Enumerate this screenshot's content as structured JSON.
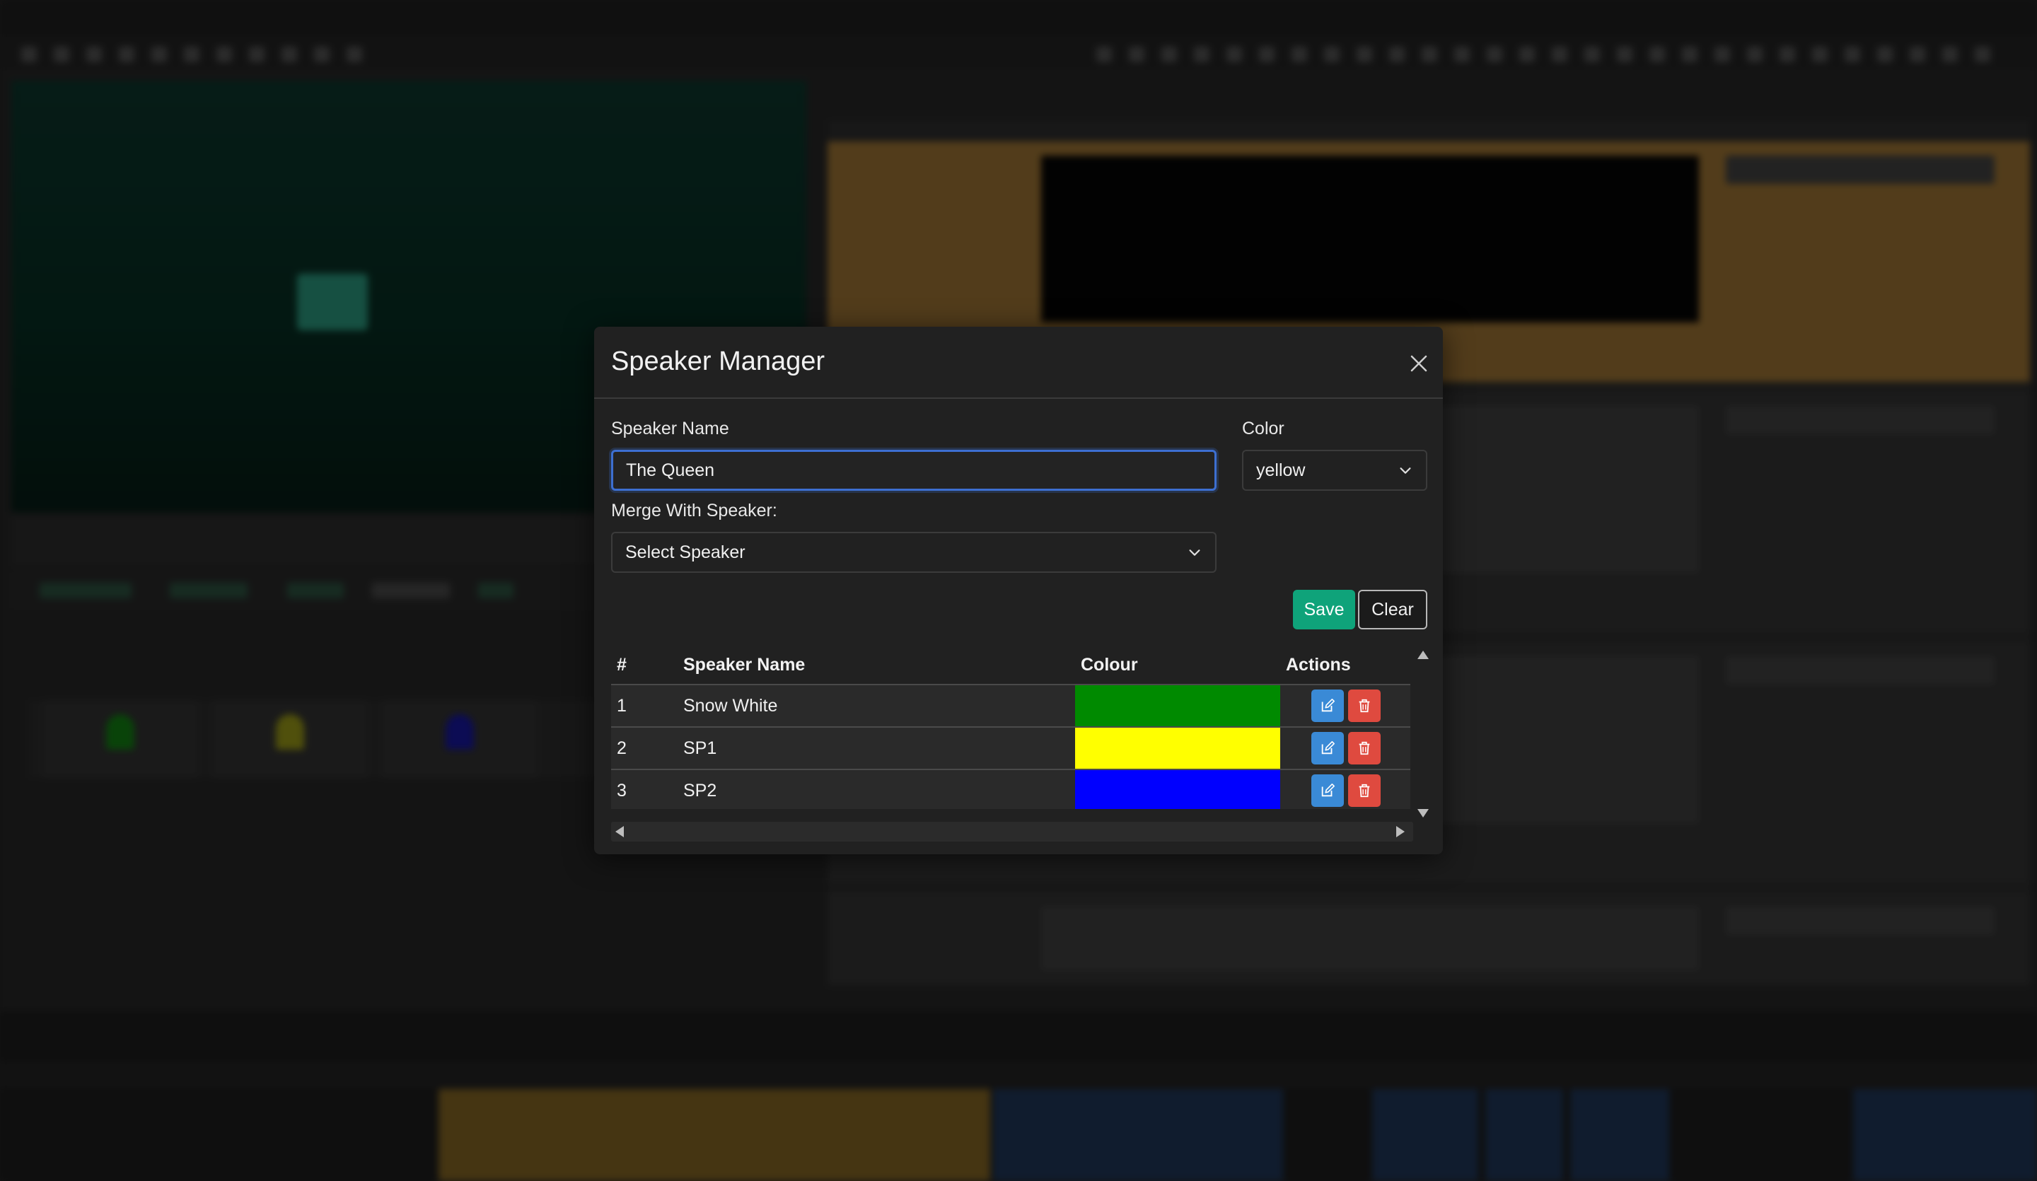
{
  "modal": {
    "title": "Speaker Manager",
    "close_icon": "close-icon",
    "speaker_name_label": "Speaker Name",
    "speaker_name_value": "The Queen",
    "color_label": "Color",
    "color_value": "yellow",
    "merge_label": "Merge With Speaker:",
    "merge_value": "Select Speaker",
    "save_label": "Save",
    "clear_label": "Clear",
    "table": {
      "headers": [
        "#",
        "Speaker Name",
        "Colour",
        "Actions"
      ],
      "rows": [
        {
          "num": "1",
          "name": "Snow White",
          "colour": "#008a00"
        },
        {
          "num": "2",
          "name": "SP1",
          "colour": "#ffff00"
        },
        {
          "num": "3",
          "name": "SP2",
          "colour": "#0000ff"
        }
      ]
    }
  },
  "colors": {
    "accent_save": "#0fa37a",
    "edit_button": "#3a8ad6",
    "delete_button": "#df4a3f",
    "focus_border": "#3d6fd1"
  },
  "icons": {
    "edit": "pencil-square-icon",
    "delete": "trash-icon",
    "dropdown": "chevron-down-icon"
  }
}
